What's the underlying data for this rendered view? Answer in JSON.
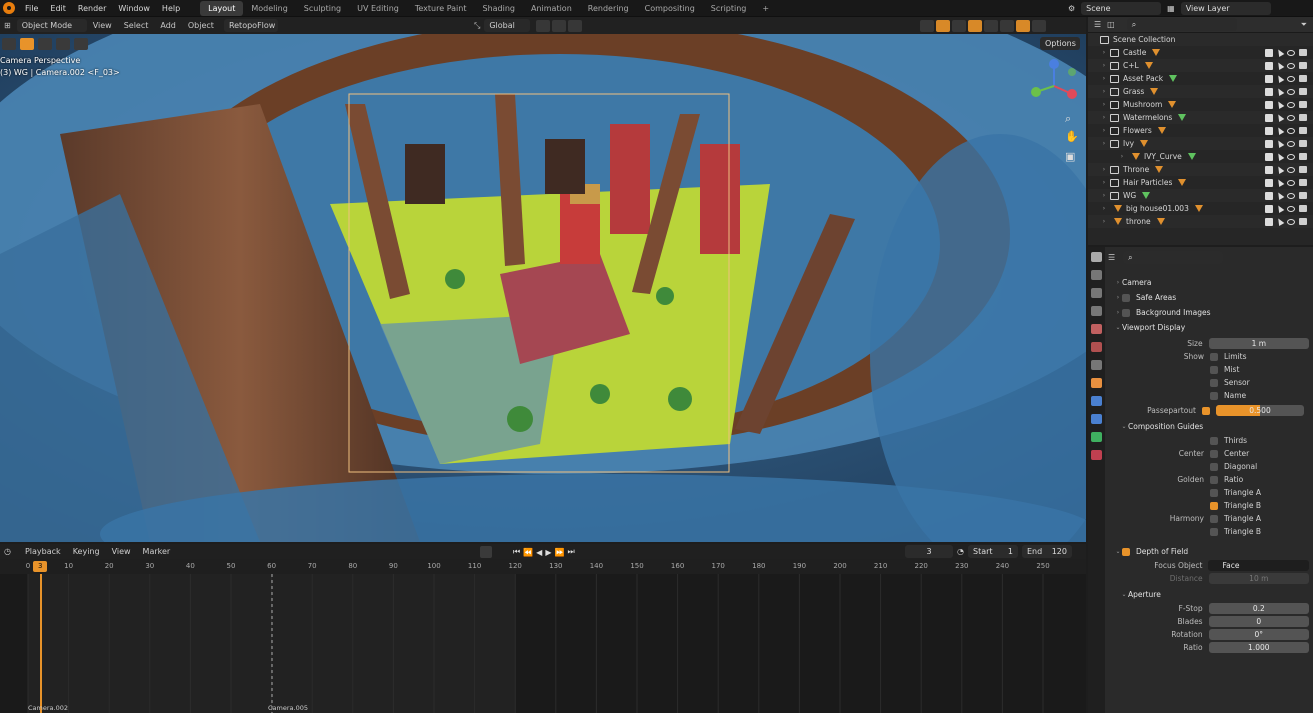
{
  "topbar": {
    "menus": [
      "File",
      "Edit",
      "Render",
      "Window",
      "Help"
    ],
    "workspaces": [
      "Layout",
      "Modeling",
      "Sculpting",
      "UV Editing",
      "Texture Paint",
      "Shading",
      "Animation",
      "Rendering",
      "Compositing",
      "Scripting"
    ],
    "active_workspace": "Layout",
    "add_tab": "+",
    "scene": "Scene",
    "view_layer": "View Layer"
  },
  "viewport_header": {
    "mode": "Object Mode",
    "menus": [
      "View",
      "Select",
      "Add",
      "Object",
      "RetopoFlow"
    ],
    "transform": "Global",
    "options": "Options"
  },
  "viewport": {
    "title": "Camera Perspective",
    "subtitle": "(3) WG | Camera.002 <F_03>"
  },
  "outliner": {
    "root": "Scene Collection",
    "items": [
      {
        "name": "Castle",
        "type": "collection"
      },
      {
        "name": "C+L",
        "type": "collection"
      },
      {
        "name": "Asset Pack",
        "type": "collection"
      },
      {
        "name": "Grass",
        "type": "collection"
      },
      {
        "name": "Mushroom",
        "type": "collection"
      },
      {
        "name": "Watermelons",
        "type": "collection"
      },
      {
        "name": "Flowers",
        "type": "collection"
      },
      {
        "name": "Ivy",
        "type": "collection"
      },
      {
        "name": "IVY_Curve",
        "type": "object"
      },
      {
        "name": "Throne",
        "type": "collection"
      },
      {
        "name": "Hair Particles",
        "type": "collection"
      },
      {
        "name": "WG",
        "type": "collection"
      },
      {
        "name": "big house01.003",
        "type": "object"
      },
      {
        "name": "throne",
        "type": "object"
      }
    ]
  },
  "properties": {
    "sections": {
      "camera": "Camera",
      "safe_areas": "Safe Areas",
      "background_images": "Background Images",
      "viewport_display": "Viewport Display"
    },
    "size_label": "Size",
    "size_value": "1 m",
    "show_label": "Show",
    "show_options": [
      "Limits",
      "Mist",
      "Sensor",
      "Name"
    ],
    "passepartout_label": "Passepartout",
    "passepartout_value": "0.500",
    "passepartout_fraction": 0.5,
    "composition_guides": "Composition Guides",
    "thirds": "Thirds",
    "center_label": "Center",
    "center_options": [
      "Center",
      "Diagonal"
    ],
    "golden_label": "Golden",
    "golden_options": [
      "Ratio",
      "Triangle A",
      "Triangle B"
    ],
    "harmony_label": "Harmony",
    "harmony_options": [
      "Triangle A",
      "Triangle B"
    ],
    "depth_of_field": "Depth of Field",
    "focus_object_label": "Focus Object",
    "focus_object_value": "Face",
    "distance_label": "Distance",
    "distance_value": "10 m",
    "aperture": "Aperture",
    "fstop_label": "F-Stop",
    "fstop_value": "0.2",
    "blades_label": "Blades",
    "blades_value": "0",
    "rotation_label": "Rotation",
    "rotation_value": "0°",
    "ratio_label": "Ratio",
    "ratio_value": "1.000"
  },
  "timeline": {
    "menus": [
      "Playback",
      "Keying",
      "View",
      "Marker"
    ],
    "current_frame": "3",
    "start_label": "Start",
    "start_value": "1",
    "end_label": "End",
    "end_value": "120",
    "ruler_ticks": [
      "0",
      "10",
      "20",
      "30",
      "40",
      "50",
      "60",
      "70",
      "80",
      "90",
      "100",
      "110",
      "120",
      "130",
      "140",
      "150",
      "160",
      "170",
      "180",
      "190",
      "200",
      "210",
      "220",
      "230",
      "240",
      "250"
    ],
    "markers": [
      "Camera.002",
      "Camera.005"
    ]
  },
  "colors": {
    "accent": "#e8932a",
    "panel": "#2a2a2a",
    "header": "#181818"
  }
}
